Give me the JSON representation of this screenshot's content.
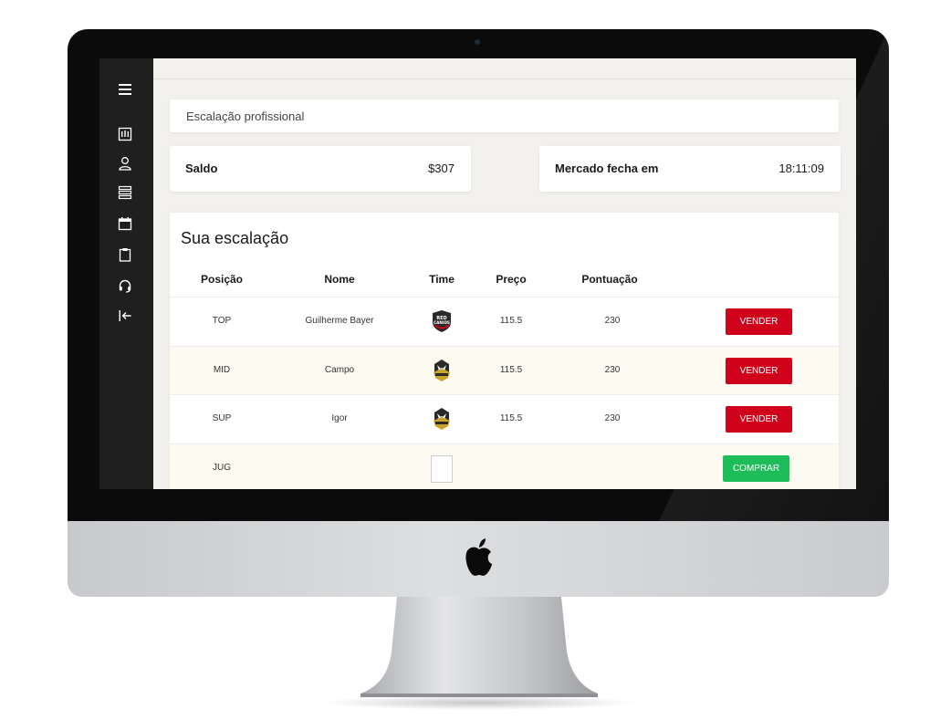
{
  "breadcrumb": "Escalação profissional",
  "balance": {
    "label": "Saldo",
    "value": "$307"
  },
  "market": {
    "label": "Mercado fecha em",
    "value": "18:11:09"
  },
  "lineup": {
    "title": "Sua escalação",
    "headers": {
      "position": "Posição",
      "name": "Nome",
      "team": "Time",
      "price": "Preço",
      "score": "Pontuação"
    },
    "rows": [
      {
        "position": "TOP",
        "name": "Guilherme Bayer",
        "team_logo": "red-canids-logo",
        "price": "115.5",
        "score": "230",
        "action": "VENDER"
      },
      {
        "position": "MID",
        "name": "Campo",
        "team_logo": "gold-wolf-logo",
        "price": "115.5",
        "score": "230",
        "action": "VENDER"
      },
      {
        "position": "SUP",
        "name": "Igor",
        "team_logo": "gold-wolf-logo",
        "price": "115.5",
        "score": "230",
        "action": "VENDER"
      },
      {
        "position": "JUG",
        "name": "",
        "team_logo": "empty-slot",
        "price": "",
        "score": "",
        "action": "COMPRAR"
      }
    ]
  },
  "logo_texts": {
    "red_canids_line1": "RED",
    "red_canids_line2": "CANIDS"
  },
  "sidebar_icons": [
    "menu-icon",
    "roster-icon",
    "user-icon",
    "list-icon",
    "calendar-icon",
    "clipboard-icon",
    "headset-icon",
    "collapse-icon"
  ],
  "colors": {
    "sell": "#d0021b",
    "buy": "#1fbd59",
    "sidebar": "#1f1f1f",
    "row_alt": "#fdfaf1"
  }
}
